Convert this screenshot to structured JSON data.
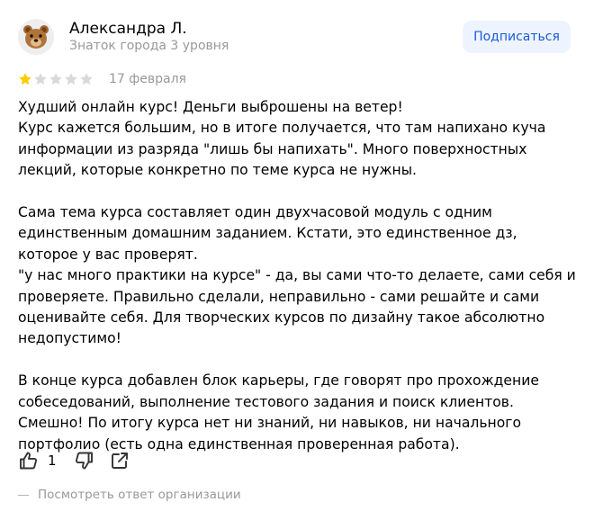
{
  "author": {
    "name": "Александра Л.",
    "level": "Знаток города 3 уровня",
    "avatar_icon": "bear-face-icon"
  },
  "subscribe_label": "Подписаться",
  "rating": {
    "value": 1,
    "max": 5,
    "filled_color": "#fc0",
    "empty_color": "#d9d9d9"
  },
  "date": "17 февраля",
  "review_text": "Худший онлайн курс! Деньги выброшены на ветер!\nКурс кажется большим, но в итоге получается, что там напихано куча информации из разряда \"лишь бы напихать\". Много поверхностных лекций, которые конкретно по теме курса не нужны.\n\nСама тема курса составляет один двухчасовой модуль с одним единственным домашним заданием. Кстати, это единственное дз, которое у вас проверят.\n\"у нас много практики на курсе\" - да, вы сами что-то делаете, сами себя и проверяете. Правильно сделали, неправильно - сами решайте и сами оценивайте себя. Для творческих курсов по дизайну такое абсолютно недопустимо!\n\nВ конце курса добавлен блок карьеры, где говорят про прохождение собеседований, выполнение тестового задания и поиск клиентов.\nСмешно! По итогу курса нет ни знаний, ни навыков, ни начального портфолио (есть одна единственная проверенная работа).",
  "actions": {
    "like_count": "1",
    "like_icon": "thumbs-up-icon",
    "dislike_icon": "thumbs-down-icon",
    "share_icon": "share-icon"
  },
  "org_reply_label": "Посмотреть ответ организации",
  "colors": {
    "accent": "#1a5ad6",
    "subscribe_bg": "#eef4ff",
    "muted": "#999999"
  }
}
